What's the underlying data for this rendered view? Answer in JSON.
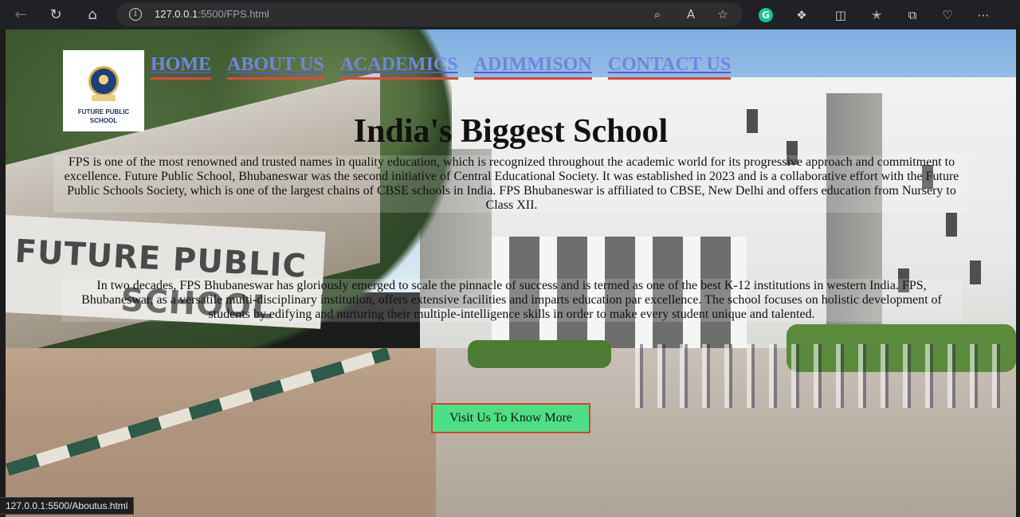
{
  "browser": {
    "url_host": "127.0.0.1",
    "url_rest": ":5500/FPS.html",
    "status_url": "127.0.0.1:5500/Aboutus.html"
  },
  "logo": {
    "line1": "FUTURE PUBLIC",
    "line2": "SCHOOL"
  },
  "nav": {
    "items": [
      {
        "label": "HOME"
      },
      {
        "label": "ABOUT US"
      },
      {
        "label": "ACADEMICS"
      },
      {
        "label": "ADIMMISON"
      },
      {
        "label": "CONTACT US"
      }
    ]
  },
  "hero": {
    "title": "India's Biggest School",
    "paragraph1": "FPS is one of the most renowned and trusted names in quality education, which is recognized throughout the academic world for its progressive approach and commitment to excellence. Future Public School, Bhubaneswar was the second initiative of Central Educational Society. It was established in 2023 and is a collaborative effort with the Future Public Schools Society, which is one of the largest chains of CBSE schools in India. FPS Bhubaneswar is affiliated to CBSE, New Delhi and offers education from Nursery to Class XII.",
    "paragraph2": "In two decades, FPS Bhubaneswar has gloriously emerged to scale the pinnacle of success and is termed as one of the best K-12 institutions in western India. FPS, Bhubaneswar, as a versatile multi-disciplinary institution, offers extensive facilities and imparts education par excellence. The school focuses on holistic development of students by edifying and nurturing their multiple-intelligence skills in order to make every student unique and talented.",
    "cta_label": "Visit Us To Know More"
  },
  "background_sign": {
    "line1": "FUTURE PUBLIC",
    "line2": "SCHOOL"
  },
  "colors": {
    "nav_link": "#6f86e0",
    "nav_underline": "#e0453a",
    "cta_bg": "#4ddf86",
    "cta_border": "#d9422f"
  }
}
